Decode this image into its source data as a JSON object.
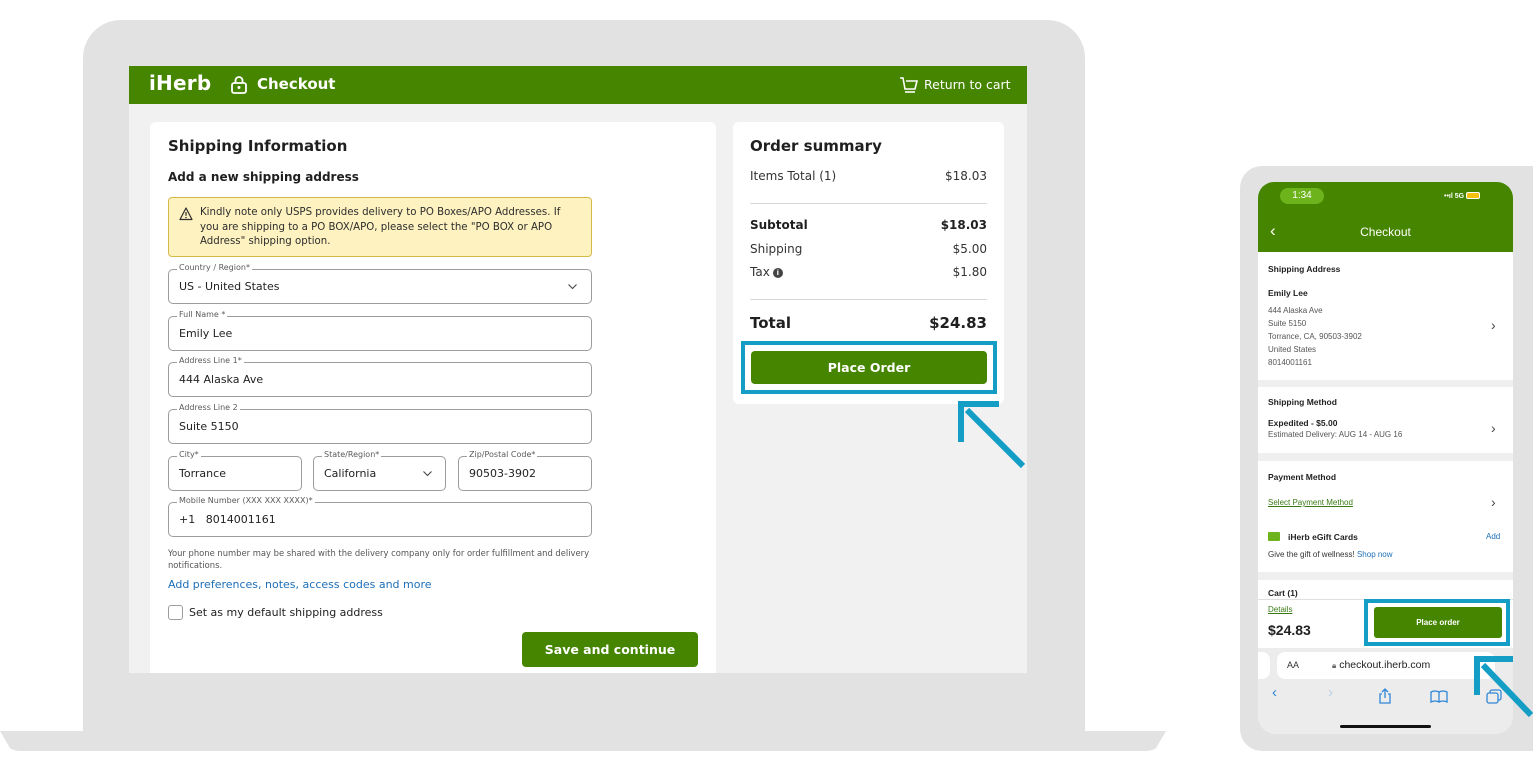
{
  "desktop": {
    "logo": "iHerb",
    "header_title": "Checkout",
    "return_link": "Return to cart",
    "shipping": {
      "title": "Shipping Information",
      "subtitle": "Add a new shipping address",
      "notice": "Kindly note only USPS provides delivery to PO Boxes/APO Addresses. If you are shipping to a PO BOX/APO, please select the \"PO BOX or APO Address\" shipping option.",
      "country": {
        "label": "Country / Region*",
        "value": "US - United States"
      },
      "full_name": {
        "label": "Full Name *",
        "value": "Emily Lee"
      },
      "address1": {
        "label": "Address Line 1*",
        "value": "444 Alaska Ave"
      },
      "address2": {
        "label": "Address Line 2",
        "value": "Suite 5150"
      },
      "city": {
        "label": "City*",
        "value": "Torrance"
      },
      "state": {
        "label": "State/Region*",
        "value": "California"
      },
      "zip": {
        "label": "Zip/Postal Code*",
        "value": "90503-3902"
      },
      "mobile": {
        "label": "Mobile Number (XXX XXX XXXX)*",
        "value": "+1   8014001161"
      },
      "helper": "Your phone number may be shared with the delivery company only for order fulfillment and delivery notifications.",
      "preferences_link": "Add preferences, notes, access codes and more",
      "default_checkbox_label": "Set as my default shipping address",
      "save_button": "Save and continue"
    },
    "summary": {
      "title": "Order summary",
      "items_total_label": "Items Total (1)",
      "items_total_value": "$18.03",
      "subtotal_label": "Subtotal",
      "subtotal_value": "$18.03",
      "shipping_label": "Shipping",
      "shipping_value": "$5.00",
      "tax_label": "Tax",
      "tax_value": "$1.80",
      "total_label": "Total",
      "total_value": "$24.83",
      "place_order": "Place Order"
    }
  },
  "mobile": {
    "time": "1:34",
    "signal": "5G",
    "header_title": "Checkout",
    "shipping_address": {
      "heading": "Shipping Address",
      "name": "Emily Lee",
      "lines": [
        "444 Alaska Ave",
        "Suite 5150",
        "Torrance, CA, 90503-3902",
        "United States",
        "8014001161"
      ]
    },
    "shipping_method": {
      "heading": "Shipping Method",
      "method": "Expedited - $5.00",
      "estimate": "Estimated Delivery: AUG 14 - AUG 16"
    },
    "payment_method": {
      "heading": "Payment Method",
      "link": "Select Payment Method"
    },
    "gift_cards": {
      "title": "iHerb eGift Cards",
      "add": "Add",
      "text": "Give the gift of wellness!",
      "shop_now": "Shop now"
    },
    "cart": {
      "heading": "Cart (1)",
      "details_link": "Details",
      "total": "$24.83",
      "place_order": "Place order"
    },
    "browser": {
      "aa": "AA",
      "domain": "checkout.iherb.com"
    }
  },
  "colors": {
    "brand_green": "#458500",
    "highlight_blue": "#149ec6",
    "notice_bg": "#fdf2c0",
    "link_blue": "#1d6fb8"
  }
}
